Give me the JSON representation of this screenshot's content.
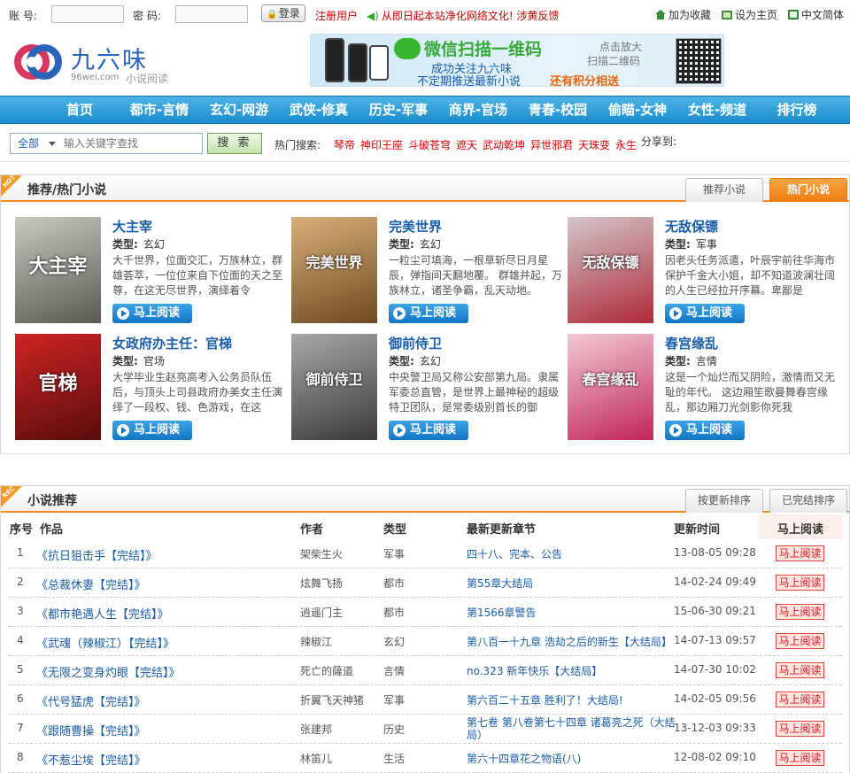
{
  "topbar": {
    "account_label": "账  号:",
    "password_label": "密  码:",
    "login_label": "登录",
    "register_label": "注册用户",
    "notice": "从即日起本站净化网络文化! 涉黄反馈",
    "favorites_label": "加为收藏",
    "homepage_label": "设为主页",
    "language_label": "中文简体"
  },
  "header": {
    "logo_name": "九六味",
    "logo_domain": "96wei.com",
    "logo_sub": "小说阅读",
    "banner": {
      "headline": "微信扫描一维码",
      "line1": "成功关注九六味",
      "line2": "不定期推送最新小说",
      "line2_highlight": "还有积分相送",
      "hint1": "点击放大",
      "hint2": "扫描二维码"
    }
  },
  "nav": [
    "首页",
    "都市-言情",
    "玄幻-网游",
    "武侠-修真",
    "历史-军事",
    "商界-官场",
    "青春-校园",
    "偷瞄-女神",
    "女性-频道",
    "排行榜"
  ],
  "search": {
    "scope": "全部",
    "placeholder": "输入关键字查找",
    "button": "搜  索",
    "hot_label": "热门搜索:",
    "hot_words": [
      "琴帝",
      "神印王座",
      "斗破苍穹",
      "遮天",
      "武动乾坤",
      "异世邪君",
      "天珠变",
      "永生"
    ],
    "share_label": "分享到:"
  },
  "featured": {
    "badge": "HOT",
    "title": "推荐/热门小说",
    "tabs": [
      "推荐小说",
      "热门小说"
    ],
    "active_tab": "热门小说",
    "genre_label": "类型:",
    "read_label": "马上阅读",
    "books": [
      {
        "title": "大主宰",
        "genre": "玄幻",
        "desc": "大千世界，位面交汇，万族林立，群雄荟萃，一位位来自下位面的天之至尊，在这无尽世界，演绎着令",
        "cover_text": "大主宰",
        "colors": [
          "#c9c9c2",
          "#5a5a52"
        ]
      },
      {
        "title": "完美世界",
        "genre": "玄幻",
        "desc": "一粒尘可填海，一根草斩尽日月星辰，弹指间天翻地覆。 群雄并起，万族林立，诸圣争霸，乱天动地。",
        "cover_text": "完美世界",
        "colors": [
          "#d9b07a",
          "#6e4a22"
        ]
      },
      {
        "title": "无敌保镖",
        "genre": "军事",
        "desc": "因老头任务派遣，叶辰宇前往华海市保护千金大小姐，却不知道波澜壮阔的人生已经拉开序幕。卑鄙是",
        "cover_text": "无敌保镖",
        "colors": [
          "#d2c6c8",
          "#b02a3a"
        ]
      },
      {
        "title": "女政府办主任：官梯",
        "genre": "官场",
        "desc": "大学毕业生赵亮高考入公务员队伍后，与顶头上司县政府办美女主任演绎了一段权、钱、色游戏，在这",
        "cover_text": "官梯",
        "colors": [
          "#cf2424",
          "#5a0d0d"
        ]
      },
      {
        "title": "御前侍卫",
        "genre": "玄幻",
        "desc": "中央警卫局又称公安部第九局。隶属军委总直管，是世界上最神秘的超级特卫团队，是常委级别首长的御",
        "cover_text": "御前侍卫",
        "colors": [
          "#a8a8a8",
          "#3a3a3a"
        ]
      },
      {
        "title": "春宫缘乱",
        "genre": "言情",
        "desc": "这是一个灿烂而又阴险，激情而又无耻的年代。 这边厢笙歌曼舞春宫缘乱，那边厢刀光剑影你死我",
        "cover_text": "春宫缘乱",
        "colors": [
          "#f3c9d3",
          "#c0265a"
        ]
      }
    ]
  },
  "recommend": {
    "badge": "REC",
    "title": "小说推荐",
    "tabs": [
      "按更新排序",
      "已完结排序"
    ],
    "headers": {
      "num": "序号",
      "work": "作品",
      "author": "作者",
      "genre": "类型",
      "chapter": "最新更新章节",
      "time": "更新时间",
      "read": "马上阅读"
    },
    "read_label": "马上阅读",
    "rows": [
      {
        "num": "1",
        "work": "《抗日狙击手【完结】》",
        "author": "架柴生火",
        "genre": "军事",
        "chapter": "四十八、完本、公告",
        "time": "13-08-05 09:28"
      },
      {
        "num": "2",
        "work": "《总裁休妻【完结】》",
        "author": "炫舞飞扬",
        "genre": "都市",
        "chapter": "第55章大结局",
        "time": "14-02-24 09:49"
      },
      {
        "num": "3",
        "work": "《都市艳遇人生【完结】》",
        "author": "逍遥门主",
        "genre": "都市",
        "chapter": "第1566章警告",
        "time": "15-06-30 09:21"
      },
      {
        "num": "4",
        "work": "《武魂（辣椒江）【完结】》",
        "author": "辣椒江",
        "genre": "玄幻",
        "chapter": "第八百一十九章 浩劫之后的新生【大结局】",
        "time": "14-07-13 09:57"
      },
      {
        "num": "5",
        "work": "《无限之变身灼眼【完结】》",
        "author": "死亡的薩道",
        "genre": "言情",
        "chapter": "no.323 新年快乐【大结局】",
        "time": "14-07-30 10:02"
      },
      {
        "num": "6",
        "work": "《代号猛虎【完结】》",
        "author": "折翼飞天神猪",
        "genre": "军事",
        "chapter": "第六百二十五章 胜利了！大结局!",
        "time": "14-02-05 09:56"
      },
      {
        "num": "7",
        "work": "《跟随曹操【完结】》",
        "author": "张建邦",
        "genre": "历史",
        "chapter": "第七卷 第八卷第七十四章 诸葛亮之死（大结局）",
        "time": "13-12-03 09:33"
      },
      {
        "num": "8",
        "work": "《不惹尘埃【完结】》",
        "author": "林笛儿",
        "genre": "生活",
        "chapter": "第六十四章花之物语(八)",
        "time": "12-08-02 09:10"
      }
    ]
  }
}
